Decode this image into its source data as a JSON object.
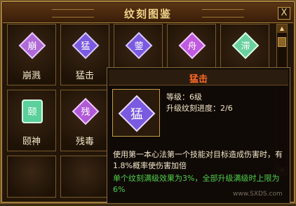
{
  "window": {
    "title": "纹刻图鉴",
    "close_label": "X"
  },
  "cells": [
    {
      "label": "崩溅",
      "glyph": "崩",
      "color": "#b06ad8"
    },
    {
      "label": "猛击",
      "glyph": "猛",
      "color": "#7a5ae0"
    },
    {
      "label": "",
      "glyph": "蓥",
      "color": "#7a5ae0"
    },
    {
      "label": "",
      "glyph": "舟",
      "color": "#c05ae0"
    },
    {
      "label": "",
      "glyph": "滞",
      "color": "#6ad0a0"
    },
    {
      "label": "颐神",
      "glyph": "颐",
      "color": "#5ad09a"
    },
    {
      "label": "残毒",
      "glyph": "残",
      "color": "#b05ad8"
    }
  ],
  "tooltip": {
    "title": "猛击",
    "glyph": "猛",
    "level": "等级：6级",
    "progress": "升级纹刻进度：2/6",
    "description": "使用第一本心法第一个技能对目标造成伤害时，有1.8%概率使伤害加倍",
    "bonus": "单个纹刻满级效果为3%，全部升级满级时上限为6%"
  },
  "watermark": "www.SXDS.com"
}
